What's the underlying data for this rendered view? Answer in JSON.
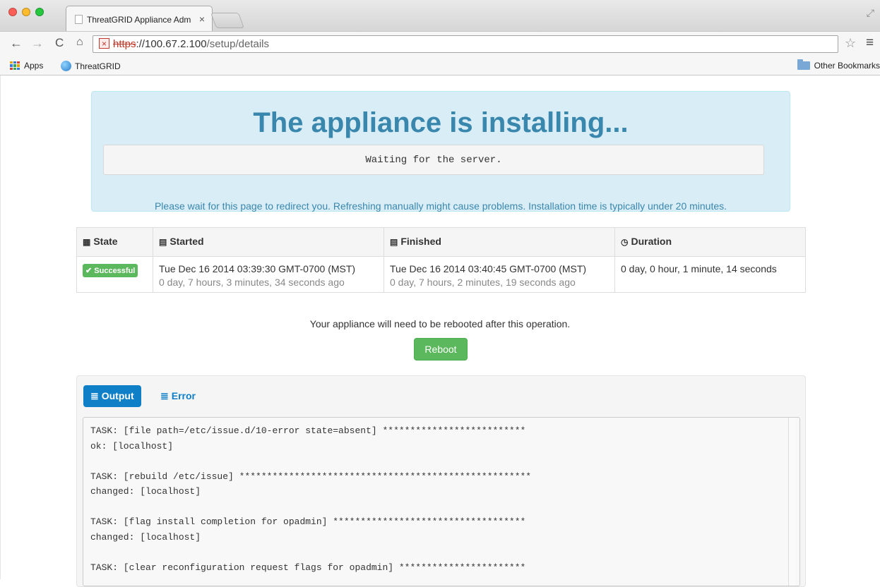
{
  "browser": {
    "tab_title": "ThreatGRID Appliance Adm",
    "tab_close": "×",
    "url_scheme": "https",
    "url_host": "://100.67.2.100",
    "url_path": "/setup/details",
    "bookmarks": [
      {
        "label": "Apps",
        "icon": "apps-grid-icon"
      },
      {
        "label": "ThreatGRID",
        "icon": "threatgrid-icon"
      }
    ],
    "other_bookmarks": "Other Bookmarks"
  },
  "alert": {
    "heading": "The appliance is installing...",
    "status": "Waiting for the server.",
    "note": "Please wait for this page to redirect you. Refreshing manually might cause problems. Installation time is typically under 20 minutes.",
    "color": "#3a87ad",
    "background": "#d9edf7"
  },
  "table": {
    "headers": {
      "state": "State",
      "started": "Started",
      "finished": "Finished",
      "duration": "Duration"
    },
    "row": {
      "state_badge": "✔ Successful",
      "started": "Tue Dec 16 2014 03:39:30 GMT-0700 (MST)",
      "started_ago": "0 day, 7 hours, 3 minutes, 34 seconds ago",
      "finished": "Tue Dec 16 2014 03:40:45 GMT-0700 (MST)",
      "finished_ago": "0 day, 7 hours, 2 minutes, 19 seconds ago",
      "duration": "0 day, 0 hour, 1 minute, 14 seconds"
    },
    "success_color": "#5cb85c"
  },
  "reboot": {
    "message": "Your appliance will need to be rebooted after this operation.",
    "button": "Reboot"
  },
  "log": {
    "tabs": {
      "output": "Output",
      "error": "Error"
    },
    "active_tab": "Output",
    "accent": "#0f7fc7",
    "text": "TASK: [file path=/etc/issue.d/10-error state=absent] **************************\nok: [localhost]\n\nTASK: [rebuild /etc/issue] *****************************************************\nchanged: [localhost]\n\nTASK: [flag install completion for opadmin] ***********************************\nchanged: [localhost]\n\nTASK: [clear reconfiguration request flags for opadmin] ***********************"
  }
}
